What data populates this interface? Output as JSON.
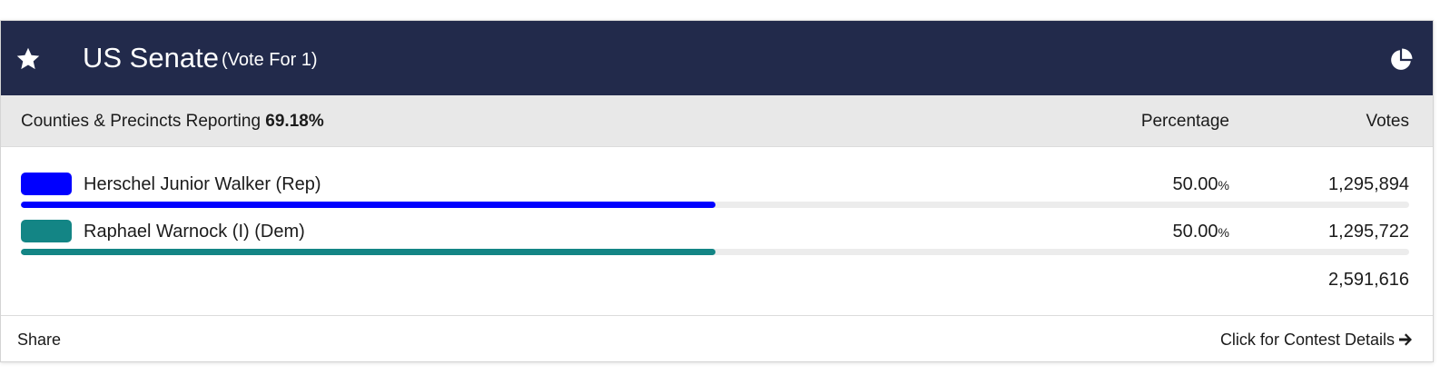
{
  "contest": {
    "title": "US Senate",
    "subtitle": "(Vote For 1)",
    "icons": {
      "favorite": "star-icon",
      "chart": "pie-chart-icon"
    },
    "header_color": "#222a4b"
  },
  "reporting": {
    "label": "Counties & Precincts Reporting",
    "value": "69.18%",
    "col_percentage": "Percentage",
    "col_votes": "Votes"
  },
  "candidates": [
    {
      "name": "Herschel Junior Walker (Rep)",
      "percentage": "50.00",
      "percent_sign": "%",
      "votes": "1,295,894",
      "color": "#0000ff",
      "bar_fraction": 0.5
    },
    {
      "name": "Raphael Warnock (I) (Dem)",
      "percentage": "50.00",
      "percent_sign": "%",
      "votes": "1,295,722",
      "color": "#138585",
      "bar_fraction": 0.5
    }
  ],
  "total_votes": "2,591,616",
  "footer": {
    "share_label": "Share",
    "details_label": "Click for Contest Details",
    "details_icon": "arrow-right-icon"
  }
}
